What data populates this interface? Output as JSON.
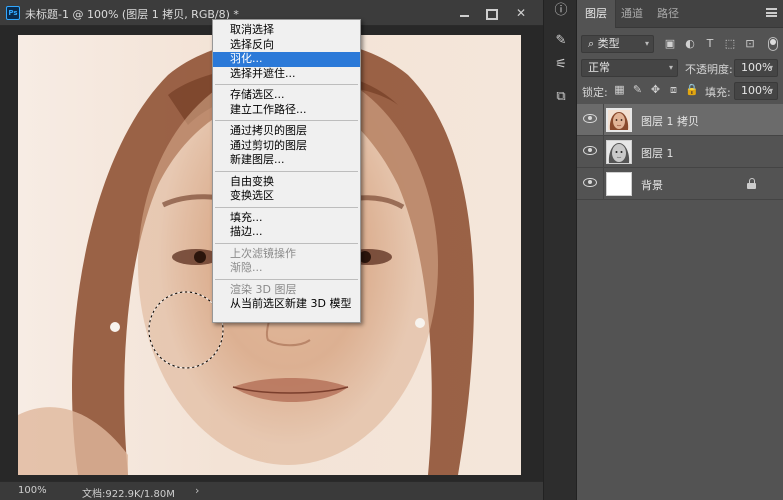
{
  "document": {
    "title": "未标题-1 @ 100% (图层 1 拷贝, RGB/8) *",
    "app_icon": "Ps"
  },
  "status_bar": {
    "zoom": "100%",
    "doc_size": "文档:922.9K/1.80M",
    "arrow": "›"
  },
  "context_menu": {
    "groups": [
      [
        "取消选择",
        "选择反向",
        "羽化...",
        "选择并遮住..."
      ],
      [
        "存储选区...",
        "建立工作路径..."
      ],
      [
        "通过拷贝的图层",
        "通过剪切的图层",
        "新建图层..."
      ],
      [
        "自由变换",
        "变换选区"
      ],
      [
        "填充...",
        "描边..."
      ],
      [
        "上次滤镜操作",
        "渐隐..."
      ],
      [
        "渲染 3D 图层",
        "从当前选区新建 3D 模型"
      ]
    ],
    "highlighted_item": "羽化...",
    "disabled_items": [
      "上次滤镜操作",
      "渐隐...",
      "渲染 3D 图层"
    ]
  },
  "layers_panel": {
    "tabs": [
      {
        "label": "图层",
        "active": true
      },
      {
        "label": "通道",
        "active": false
      },
      {
        "label": "路径",
        "active": false
      }
    ],
    "filter_kind": "类型",
    "blend_mode": "正常",
    "opacity_label": "不透明度:",
    "opacity_value": "100%",
    "lock_label": "锁定:",
    "fill_label": "填充:",
    "fill_value": "100%",
    "layers": [
      {
        "name": "图层 1 拷贝",
        "selected": true,
        "thumbnail": "sepia-face",
        "locked": false
      },
      {
        "name": "图层 1",
        "selected": false,
        "thumbnail": "gray-face",
        "locked": false
      },
      {
        "name": "背景",
        "selected": false,
        "thumbnail": "white",
        "locked": true
      }
    ]
  },
  "colors": {
    "highlight": "#2b79d8",
    "panel_bg": "#535353",
    "accent": "#31a8ff"
  }
}
